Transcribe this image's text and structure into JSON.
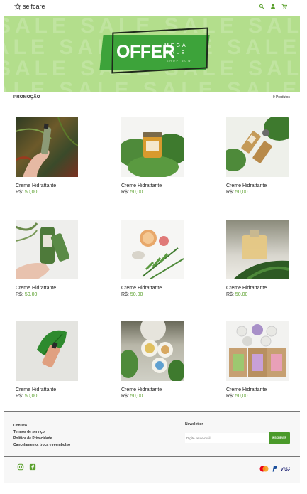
{
  "header": {
    "logo_text": "selfcare",
    "icons": [
      "search-icon",
      "user-icon",
      "cart-icon"
    ],
    "accent_color": "#5aa02c"
  },
  "banner": {
    "background_color": "#b3de8c",
    "offer": "OFFER",
    "mega": "MEGA",
    "sale": "SALE",
    "shop_now": "SHOP NOW",
    "bg_pattern": "SALE"
  },
  "section": {
    "title": "PROMOÇÃO",
    "count": "9 Produtos"
  },
  "products": [
    {
      "name": "Creme Hidrattante",
      "currency": "R$:",
      "price": "50,00"
    },
    {
      "name": "Creme Hidrattante",
      "currency": "R$:",
      "price": "50,00"
    },
    {
      "name": "Creme Hidrattante",
      "currency": "R$:",
      "price": "50,00"
    },
    {
      "name": "Creme Hidrattante",
      "currency": "R$:",
      "price": "50,00"
    },
    {
      "name": "Creme Hidrattante",
      "currency": "R$:",
      "price": "50,00"
    },
    {
      "name": "Creme Hidrattante",
      "currency": "R$:",
      "price": "50,00"
    },
    {
      "name": "Creme Hidrattante",
      "currency": "R$:",
      "price": "50,00"
    },
    {
      "name": "Creme Hidrattante",
      "currency": "R$:",
      "price": "50,00"
    },
    {
      "name": "Creme Hidrattante",
      "currency": "R$:",
      "price": "50,00"
    }
  ],
  "footer": {
    "links": [
      "Contato",
      "Termos de serviço",
      "Política de Privacidade",
      "Cancelamento, troca e reembolso"
    ],
    "newsletter_title": "Newsletter",
    "newsletter_placeholder": "Digite seu e-mail",
    "newsletter_button": "INSCREVER",
    "social": [
      "instagram-icon",
      "facebook-icon"
    ],
    "payments": [
      "mastercard-icon",
      "paypal-icon",
      "visa-icon"
    ]
  }
}
